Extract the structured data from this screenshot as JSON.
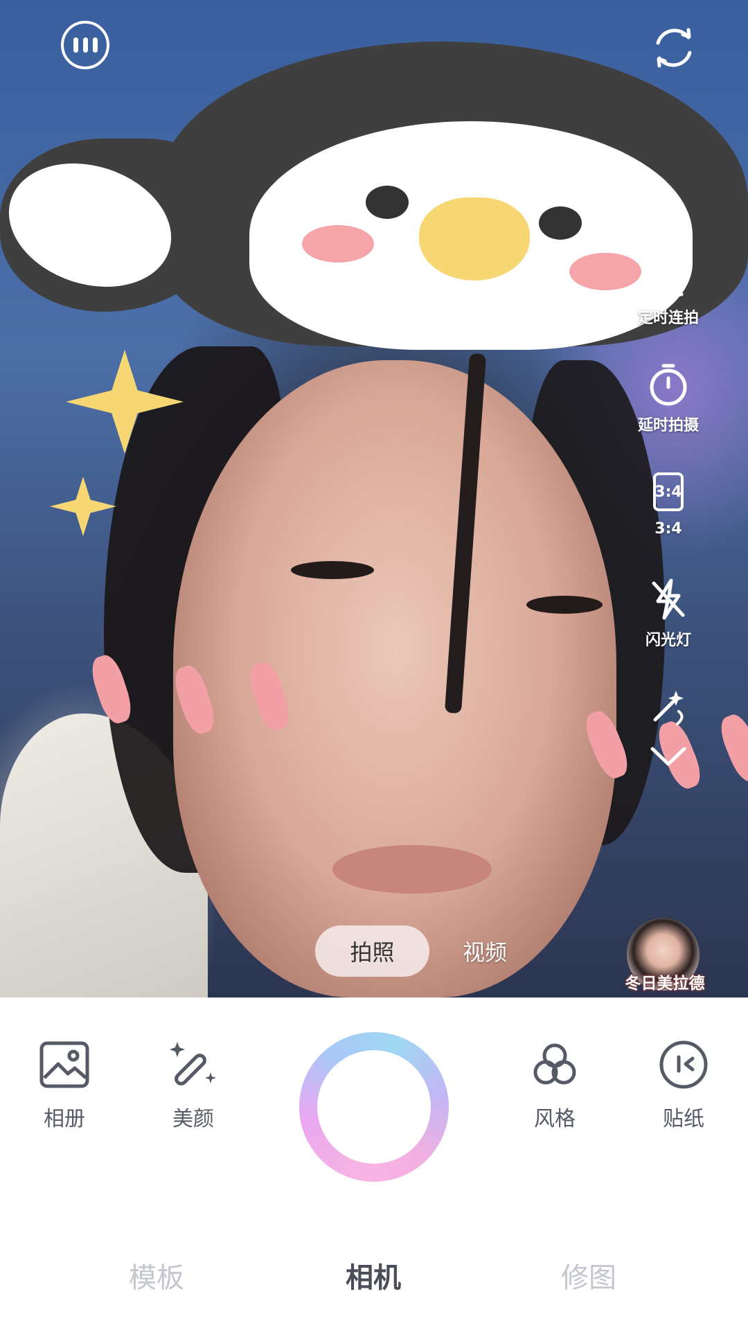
{
  "top_bar": {
    "more_icon": "more-dots-icon",
    "switch_camera_icon": "switch-camera-icon"
  },
  "side_tools": [
    {
      "name": "burst",
      "icon": "burst-timer-icon",
      "label": "定时连拍"
    },
    {
      "name": "delay",
      "icon": "stopwatch-icon",
      "label": "延时拍摄"
    },
    {
      "name": "ratio",
      "icon": "aspect-ratio-icon",
      "icon_text": "3:4",
      "label": "3:4"
    },
    {
      "name": "flash",
      "icon": "flash-off-icon",
      "label": "闪光灯"
    },
    {
      "name": "magic",
      "icon": "magic-icon",
      "label": ""
    },
    {
      "name": "expand",
      "icon": "chevron-down-icon",
      "label": ""
    }
  ],
  "mode_switch": {
    "active": "拍照",
    "other": "视频"
  },
  "filter": {
    "label": "冬日美拉德"
  },
  "bottom_tools": {
    "album": "相册",
    "beauty": "美颜",
    "style": "风格",
    "sticker": "贴纸"
  },
  "bottom_nav": {
    "template": "模板",
    "camera": "相机",
    "retouch": "修图"
  },
  "colors": {
    "nav_active": "#4a4d57",
    "nav_inactive": "#c3c6cf",
    "tool_text": "#555a66"
  }
}
